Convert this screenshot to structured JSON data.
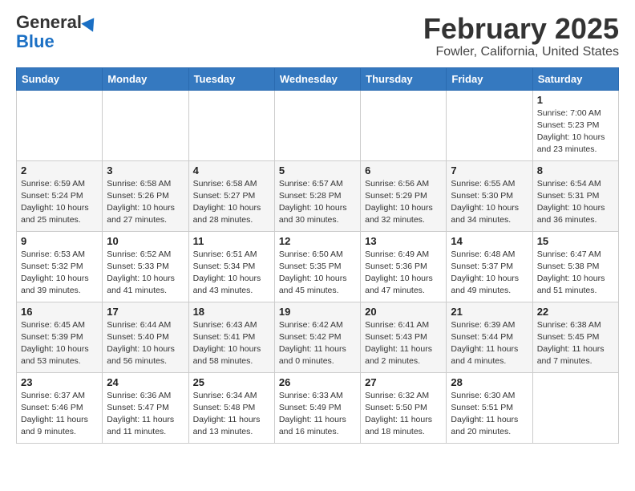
{
  "header": {
    "logo_line1": "General",
    "logo_line2": "Blue",
    "title": "February 2025",
    "subtitle": "Fowler, California, United States"
  },
  "calendar": {
    "days_of_week": [
      "Sunday",
      "Monday",
      "Tuesday",
      "Wednesday",
      "Thursday",
      "Friday",
      "Saturday"
    ],
    "weeks": [
      {
        "cells": [
          {
            "day": "",
            "info": ""
          },
          {
            "day": "",
            "info": ""
          },
          {
            "day": "",
            "info": ""
          },
          {
            "day": "",
            "info": ""
          },
          {
            "day": "",
            "info": ""
          },
          {
            "day": "",
            "info": ""
          },
          {
            "day": "1",
            "info": "Sunrise: 7:00 AM\nSunset: 5:23 PM\nDaylight: 10 hours and 23 minutes."
          }
        ]
      },
      {
        "cells": [
          {
            "day": "2",
            "info": "Sunrise: 6:59 AM\nSunset: 5:24 PM\nDaylight: 10 hours and 25 minutes."
          },
          {
            "day": "3",
            "info": "Sunrise: 6:58 AM\nSunset: 5:26 PM\nDaylight: 10 hours and 27 minutes."
          },
          {
            "day": "4",
            "info": "Sunrise: 6:58 AM\nSunset: 5:27 PM\nDaylight: 10 hours and 28 minutes."
          },
          {
            "day": "5",
            "info": "Sunrise: 6:57 AM\nSunset: 5:28 PM\nDaylight: 10 hours and 30 minutes."
          },
          {
            "day": "6",
            "info": "Sunrise: 6:56 AM\nSunset: 5:29 PM\nDaylight: 10 hours and 32 minutes."
          },
          {
            "day": "7",
            "info": "Sunrise: 6:55 AM\nSunset: 5:30 PM\nDaylight: 10 hours and 34 minutes."
          },
          {
            "day": "8",
            "info": "Sunrise: 6:54 AM\nSunset: 5:31 PM\nDaylight: 10 hours and 36 minutes."
          }
        ]
      },
      {
        "cells": [
          {
            "day": "9",
            "info": "Sunrise: 6:53 AM\nSunset: 5:32 PM\nDaylight: 10 hours and 39 minutes."
          },
          {
            "day": "10",
            "info": "Sunrise: 6:52 AM\nSunset: 5:33 PM\nDaylight: 10 hours and 41 minutes."
          },
          {
            "day": "11",
            "info": "Sunrise: 6:51 AM\nSunset: 5:34 PM\nDaylight: 10 hours and 43 minutes."
          },
          {
            "day": "12",
            "info": "Sunrise: 6:50 AM\nSunset: 5:35 PM\nDaylight: 10 hours and 45 minutes."
          },
          {
            "day": "13",
            "info": "Sunrise: 6:49 AM\nSunset: 5:36 PM\nDaylight: 10 hours and 47 minutes."
          },
          {
            "day": "14",
            "info": "Sunrise: 6:48 AM\nSunset: 5:37 PM\nDaylight: 10 hours and 49 minutes."
          },
          {
            "day": "15",
            "info": "Sunrise: 6:47 AM\nSunset: 5:38 PM\nDaylight: 10 hours and 51 minutes."
          }
        ]
      },
      {
        "cells": [
          {
            "day": "16",
            "info": "Sunrise: 6:45 AM\nSunset: 5:39 PM\nDaylight: 10 hours and 53 minutes."
          },
          {
            "day": "17",
            "info": "Sunrise: 6:44 AM\nSunset: 5:40 PM\nDaylight: 10 hours and 56 minutes."
          },
          {
            "day": "18",
            "info": "Sunrise: 6:43 AM\nSunset: 5:41 PM\nDaylight: 10 hours and 58 minutes."
          },
          {
            "day": "19",
            "info": "Sunrise: 6:42 AM\nSunset: 5:42 PM\nDaylight: 11 hours and 0 minutes."
          },
          {
            "day": "20",
            "info": "Sunrise: 6:41 AM\nSunset: 5:43 PM\nDaylight: 11 hours and 2 minutes."
          },
          {
            "day": "21",
            "info": "Sunrise: 6:39 AM\nSunset: 5:44 PM\nDaylight: 11 hours and 4 minutes."
          },
          {
            "day": "22",
            "info": "Sunrise: 6:38 AM\nSunset: 5:45 PM\nDaylight: 11 hours and 7 minutes."
          }
        ]
      },
      {
        "cells": [
          {
            "day": "23",
            "info": "Sunrise: 6:37 AM\nSunset: 5:46 PM\nDaylight: 11 hours and 9 minutes."
          },
          {
            "day": "24",
            "info": "Sunrise: 6:36 AM\nSunset: 5:47 PM\nDaylight: 11 hours and 11 minutes."
          },
          {
            "day": "25",
            "info": "Sunrise: 6:34 AM\nSunset: 5:48 PM\nDaylight: 11 hours and 13 minutes."
          },
          {
            "day": "26",
            "info": "Sunrise: 6:33 AM\nSunset: 5:49 PM\nDaylight: 11 hours and 16 minutes."
          },
          {
            "day": "27",
            "info": "Sunrise: 6:32 AM\nSunset: 5:50 PM\nDaylight: 11 hours and 18 minutes."
          },
          {
            "day": "28",
            "info": "Sunrise: 6:30 AM\nSunset: 5:51 PM\nDaylight: 11 hours and 20 minutes."
          },
          {
            "day": "",
            "info": ""
          }
        ]
      }
    ]
  }
}
